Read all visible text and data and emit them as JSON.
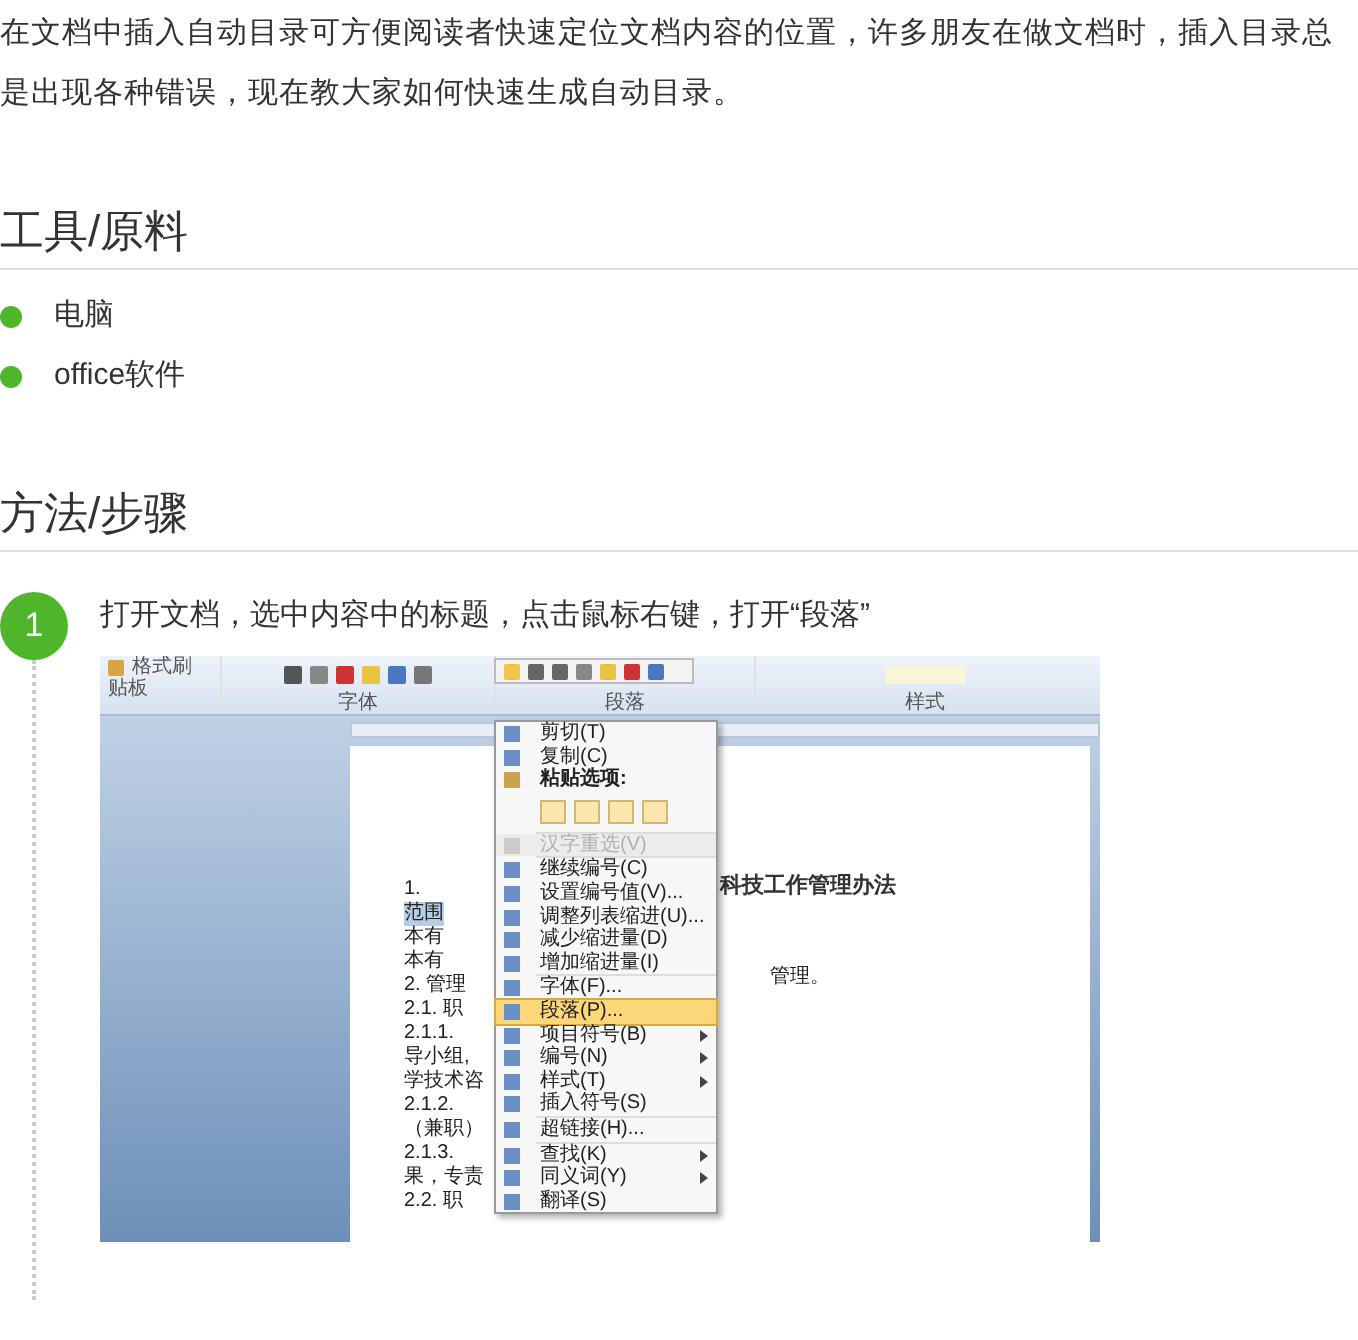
{
  "intro": "在文档中插入自动目录可方便阅读者快速定位文档内容的位置，许多朋友在做文档时，插入目录总是出现各种错误，现在教大家如何快速生成自动目录。",
  "sections": [
    {
      "title": "工具/原料",
      "kind": "list",
      "items": [
        "电脑",
        "office软件"
      ]
    },
    {
      "title": "方法/步骤",
      "kind": "steps",
      "steps": [
        {
          "number": "1",
          "text": "打开文档，选中内容中的标题，点击鼠标右键，打开“段落”",
          "screenshot": {
            "ribbon": {
              "button": "格式刷",
              "groups": [
                "贴板",
                "字体",
                "段落",
                "样式"
              ]
            },
            "doc_title": "科技工作管理办法",
            "doc_left_lines": [
              {
                "text": "1.",
                "selected": false
              },
              {
                "text": "范围",
                "selected": true
              },
              {
                "text": "本有",
                "selected": false
              },
              {
                "text": "本有",
                "selected": false
              },
              {
                "text": "2. 管理",
                "selected": false
              },
              {
                "text": "2.1. 职",
                "selected": false
              },
              {
                "text": "2.1.1.",
                "selected": false
              },
              {
                "text": "导小组,",
                "selected": false
              },
              {
                "text": "学技术咨",
                "selected": false
              },
              {
                "text": "2.1.2.",
                "selected": false
              },
              {
                "text": "（兼职）",
                "selected": false
              },
              {
                "text": "2.1.3.",
                "selected": false
              },
              {
                "text": "果，专责",
                "selected": false
              },
              {
                "text": "2.2. 职",
                "selected": false
              }
            ],
            "doc_right_lines": [
              "管理。"
            ],
            "menu_groups": [
              [
                {
                  "label": "剪切(T)",
                  "kind": "item",
                  "selected": false,
                  "disabled": false,
                  "submenu": false
                },
                {
                  "label": "复制(C)",
                  "kind": "item",
                  "selected": false,
                  "disabled": false,
                  "submenu": false
                },
                {
                  "label": "粘贴选项:",
                  "kind": "paste"
                }
              ],
              [
                {
                  "label": "汉字重选(V)",
                  "kind": "item",
                  "selected": false,
                  "disabled": true,
                  "submenu": false
                }
              ],
              [
                {
                  "label": "继续编号(C)",
                  "kind": "item",
                  "selected": false,
                  "disabled": false,
                  "submenu": false
                },
                {
                  "label": "设置编号值(V)...",
                  "kind": "item",
                  "selected": false,
                  "disabled": false,
                  "submenu": false
                },
                {
                  "label": "调整列表缩进(U)...",
                  "kind": "item",
                  "selected": false,
                  "disabled": false,
                  "submenu": false
                },
                {
                  "label": "减少缩进量(D)",
                  "kind": "item",
                  "selected": false,
                  "disabled": false,
                  "submenu": false
                },
                {
                  "label": "增加缩进量(I)",
                  "kind": "item",
                  "selected": false,
                  "disabled": false,
                  "submenu": false
                }
              ],
              [
                {
                  "label": "字体(F)...",
                  "kind": "item",
                  "selected": false,
                  "disabled": false,
                  "submenu": false
                },
                {
                  "label": "段落(P)...",
                  "kind": "item",
                  "selected": true,
                  "disabled": false,
                  "submenu": false
                },
                {
                  "label": "项目符号(B)",
                  "kind": "item",
                  "selected": false,
                  "disabled": false,
                  "submenu": true
                },
                {
                  "label": "编号(N)",
                  "kind": "item",
                  "selected": false,
                  "disabled": false,
                  "submenu": true
                },
                {
                  "label": "样式(T)",
                  "kind": "item",
                  "selected": false,
                  "disabled": false,
                  "submenu": true
                },
                {
                  "label": "插入符号(S)",
                  "kind": "item",
                  "selected": false,
                  "disabled": false,
                  "submenu": false
                }
              ],
              [
                {
                  "label": "超链接(H)...",
                  "kind": "item",
                  "selected": false,
                  "disabled": false,
                  "submenu": false
                }
              ],
              [
                {
                  "label": "查找(K)",
                  "kind": "item",
                  "selected": false,
                  "disabled": false,
                  "submenu": true
                },
                {
                  "label": "同义词(Y)",
                  "kind": "item",
                  "selected": false,
                  "disabled": false,
                  "submenu": true
                },
                {
                  "label": "翻译(S)",
                  "kind": "item",
                  "selected": false,
                  "disabled": false,
                  "submenu": false
                }
              ]
            ]
          }
        }
      ]
    }
  ]
}
